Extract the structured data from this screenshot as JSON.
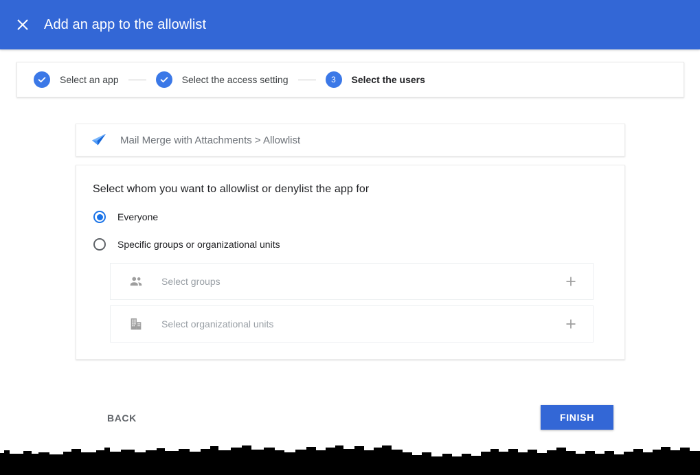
{
  "header": {
    "title": "Add an app to the allowlist",
    "close_icon": "close-icon",
    "background_color": "#3367d6"
  },
  "stepper": {
    "steps": [
      {
        "label": "Select an app",
        "state": "complete",
        "marker": "✓"
      },
      {
        "label": "Select the access setting",
        "state": "complete",
        "marker": "✓"
      },
      {
        "label": "Select the users",
        "state": "active",
        "marker": "3"
      }
    ],
    "accent_color": "#3b78e7"
  },
  "app_card": {
    "icon": "paper-plane-icon",
    "name": "Mail Merge with Attachments > Allowlist"
  },
  "main": {
    "heading": "Select whom you want to allowlist or denylist the app for",
    "options": [
      {
        "label": "Everyone",
        "selected": true
      },
      {
        "label": "Specific groups or organizational units",
        "selected": false
      }
    ],
    "selectors": [
      {
        "icon": "group-people-icon",
        "placeholder": "Select groups",
        "value": "",
        "action_icon": "plus-icon"
      },
      {
        "icon": "building-domain-icon",
        "placeholder": "Select organizational units",
        "value": "",
        "action_icon": "plus-icon"
      }
    ],
    "selected_color": "#1a73e8"
  },
  "footer": {
    "back_label": "BACK",
    "finish_label": "FINISH",
    "finish_color": "#3367d6"
  }
}
